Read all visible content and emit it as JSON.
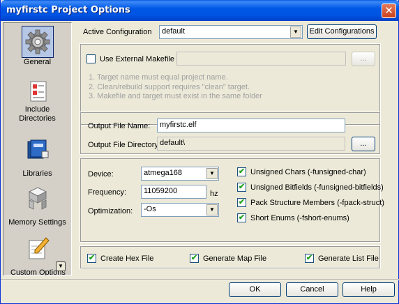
{
  "window": {
    "title": "myfirstc Project Options",
    "close_glyph": "✕"
  },
  "sidebar": {
    "items": [
      {
        "label": "General",
        "icon": "gear-icon"
      },
      {
        "label": "Include Directories",
        "icon": "directory-icon"
      },
      {
        "label": "Libraries",
        "icon": "books-icon"
      },
      {
        "label": "Memory Settings",
        "icon": "blocks-icon"
      },
      {
        "label": "Custom Options",
        "icon": "pencil-note-icon"
      }
    ],
    "scroll_glyph": "▼"
  },
  "config": {
    "label": "Active Configuration",
    "value": "default",
    "edit_button": "Edit Configurations"
  },
  "makefile": {
    "checkbox_label": "Use External Makefile",
    "path_value": "",
    "browse_label": "...",
    "notes": [
      "1. Target name must equal project name.",
      "2. Clean/rebuild support requires  \"clean\" target.",
      "3. Makefile and target must exist in the same folder"
    ]
  },
  "output": {
    "file_name_label": "Output File Name:",
    "file_name_value": "myfirstc.elf",
    "dir_label": "Output File Directory:",
    "dir_value": "default\\",
    "browse_label": "..."
  },
  "device": {
    "device_label": "Device:",
    "device_value": "atmega168",
    "frequency_label": "Frequency:",
    "frequency_value": "11059200",
    "frequency_unit": "hz",
    "optimization_label": "Optimization:",
    "optimization_value": "-Os"
  },
  "compiler_flags": [
    {
      "label": "Unsigned Chars (-funsigned-char)",
      "checked": true
    },
    {
      "label": "Unsigned Bitfields (-funsigned-bitfields)",
      "checked": true
    },
    {
      "label": "Pack Structure Members (-fpack-struct)",
      "checked": true
    },
    {
      "label": "Short Enums (-fshort-enums)",
      "checked": true
    }
  ],
  "generate": {
    "hex": "Create Hex File",
    "map": "Generate Map File",
    "list": "Generate List File"
  },
  "check_glyph": "✔",
  "dropdown_glyph": "▼",
  "buttons": {
    "ok": "OK",
    "cancel": "Cancel",
    "help": "Help"
  },
  "colors": {
    "title_bar": "#0054e3",
    "dialog_bg": "#ece9d8",
    "selected_item": "#b6c7e6"
  }
}
